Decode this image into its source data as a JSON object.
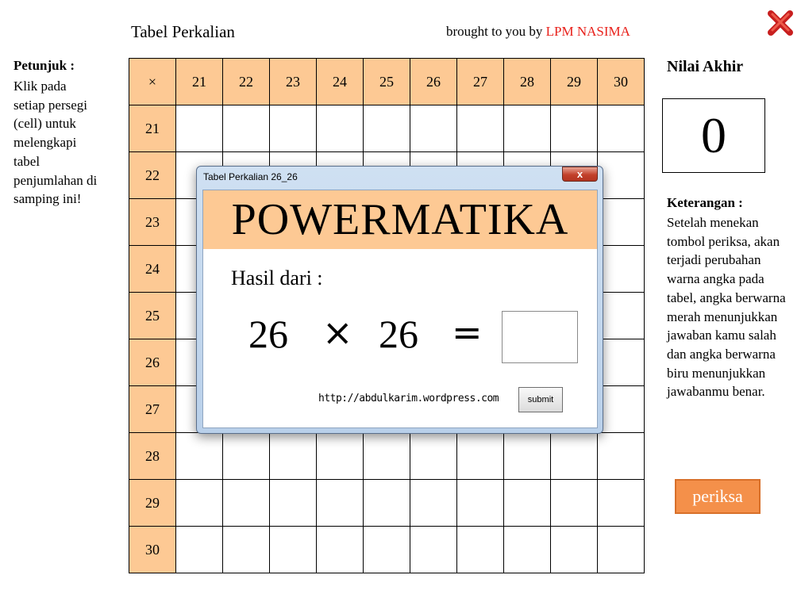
{
  "header": {
    "title": "Tabel Perkalian",
    "credit_prefix": "brought to you by ",
    "credit_brand": "LPM NASIMA",
    "close_icon": "red-x-close-icon"
  },
  "instructions": {
    "title": "Petunjuk :",
    "text": "Klik pada setiap persegi (cell) untuk melengkapi tabel penjumlahan di samping ini!"
  },
  "grid": {
    "corner_symbol": "×",
    "column_headers": [
      "21",
      "22",
      "23",
      "24",
      "25",
      "26",
      "27",
      "28",
      "29",
      "30"
    ],
    "row_headers": [
      "21",
      "22",
      "23",
      "24",
      "25",
      "26",
      "27",
      "28",
      "29",
      "30"
    ],
    "header_color": "#fdc994"
  },
  "score": {
    "label": "Nilai Akhir",
    "value": "0"
  },
  "notes": {
    "title": "Keterangan :",
    "text": "Setelah menekan tombol periksa, akan terjadi perubahan warna angka pada tabel, angka berwarna merah menunjukkan jawaban kamu salah dan angka berwarna biru menunjukkan jawabanmu benar."
  },
  "check_button": {
    "label": "periksa",
    "color": "#f4904a"
  },
  "dialog": {
    "title": "Tabel Perkalian 26_26",
    "close_label": "x",
    "banner": "POWERMATIKA",
    "result_label": "Hasil dari :",
    "operand_a": "26",
    "operator": "×",
    "operand_b": "26",
    "equals": "=",
    "answer_value": "",
    "url": "http://abdulkarim.wordpress.com",
    "submit_label": "submit"
  }
}
